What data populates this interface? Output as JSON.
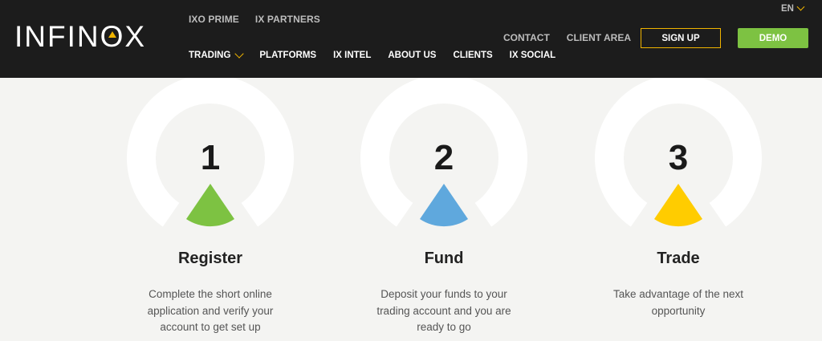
{
  "header": {
    "logo": {
      "text_before": "INFIN",
      "text_o": "O",
      "text_after": "X"
    },
    "top_links": [
      "IXO PRIME",
      "IX PARTNERS"
    ],
    "nav": {
      "trading": "TRADING",
      "platforms": "PLATFORMS",
      "ix_intel": "IX INTEL",
      "about_us": "ABOUT US",
      "clients": "CLIENTS",
      "ix_social": "IX SOCIAL"
    },
    "language": "EN",
    "contact": "CONTACT",
    "client_area": "CLIENT AREA",
    "signup_label": "SIGN UP",
    "demo_label": "DEMO"
  },
  "colors": {
    "header_bg": "#1c1c1c",
    "accent_yellow": "#f0b400",
    "demo_green": "#7dc242",
    "step1": "#7dc242",
    "step2": "#5fa8dd",
    "step3": "#ffcc00"
  },
  "steps": [
    {
      "number": "1",
      "title": "Register",
      "description": "Complete the short online application and verify your account to get set up"
    },
    {
      "number": "2",
      "title": "Fund",
      "description": "Deposit your funds to your trading account and you are ready to go"
    },
    {
      "number": "3",
      "title": "Trade",
      "description": "Take advantage of the next opportunity"
    }
  ]
}
